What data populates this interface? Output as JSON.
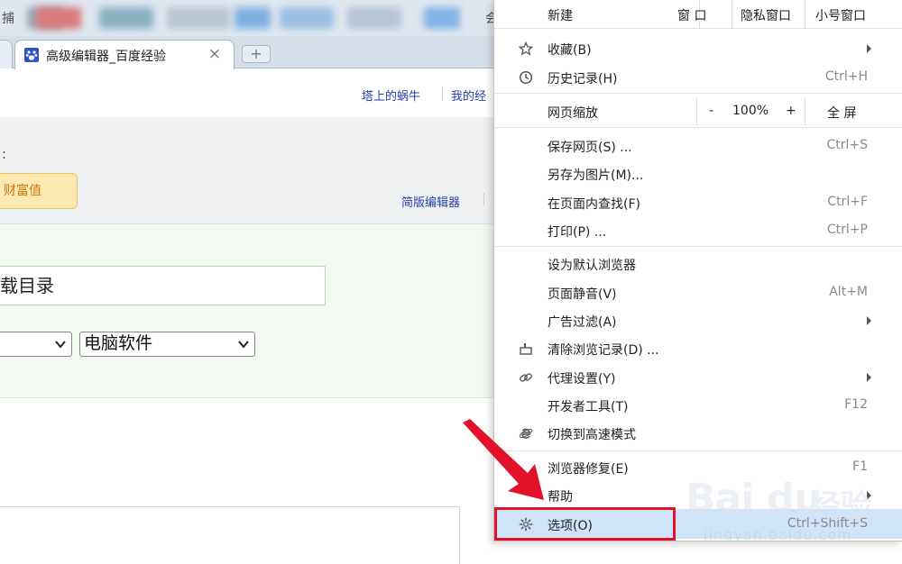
{
  "browser": {
    "bookmark_char_1": "捕",
    "bookmark_char_2": "会",
    "active_tab_title": "高级编辑器_百度经验",
    "close_glyph": "×",
    "new_tab_glyph": "+"
  },
  "page": {
    "user_link": "塔上的蜗牛",
    "my_link": "我的经",
    "colon_label": ":",
    "wealth_label": "财富值",
    "simple_editor_link": "简版编辑器",
    "title_input_value": "载目录",
    "category_select_value": "电脑软件"
  },
  "menu": {
    "new_label": "新建",
    "window_label": "窗 口",
    "incognito_label": "隐私窗口",
    "small_window_label": "小号窗口",
    "items": [
      {
        "label": "收藏(B)",
        "shortcut": "",
        "icon": "star-icon",
        "submenu": true
      },
      {
        "label": "历史记录(H)",
        "shortcut": "Ctrl+H",
        "icon": "clock-icon",
        "submenu": false
      }
    ],
    "zoom_label": "网页缩放",
    "zoom_minus": "-",
    "zoom_value": "100%",
    "zoom_plus": "+",
    "fullscreen_label": "全 屏",
    "group2": [
      {
        "label": "保存网页(S) ...",
        "shortcut": "Ctrl+S"
      },
      {
        "label": "另存为图片(M)...",
        "shortcut": ""
      },
      {
        "label": "在页面内查找(F)",
        "shortcut": "Ctrl+F"
      },
      {
        "label": "打印(P) ...",
        "shortcut": "Ctrl+P"
      }
    ],
    "group3": [
      {
        "label": "设为默认浏览器",
        "shortcut": "",
        "icon": "",
        "submenu": false
      },
      {
        "label": "页面静音(V)",
        "shortcut": "Alt+M",
        "icon": "",
        "submenu": false
      },
      {
        "label": "广告过滤(A)",
        "shortcut": "",
        "icon": "",
        "submenu": true
      },
      {
        "label": "清除浏览记录(D) ...",
        "shortcut": "",
        "icon": "eraser-icon",
        "submenu": false
      },
      {
        "label": "代理设置(Y)",
        "shortcut": "",
        "icon": "link-icon",
        "submenu": true
      },
      {
        "label": "开发者工具(T)",
        "shortcut": "F12",
        "icon": "",
        "submenu": false
      },
      {
        "label": "切换到高速模式",
        "shortcut": "",
        "icon": "ie-icon",
        "submenu": false
      }
    ],
    "group4": [
      {
        "label": "浏览器修复(E)",
        "shortcut": "F1",
        "submenu": false
      },
      {
        "label": "帮助",
        "shortcut": "",
        "submenu": true
      },
      {
        "label": "选项(O)",
        "shortcut": "Ctrl+Shift+S",
        "submenu": false
      }
    ]
  },
  "watermark": {
    "logo": "Bai du",
    "text": "经验",
    "url": "jingyan.baidu.com"
  },
  "colors": {
    "highlight": "#cfe3fb",
    "annotation_red": "#e3122a",
    "link_blue": "#2440a8"
  }
}
